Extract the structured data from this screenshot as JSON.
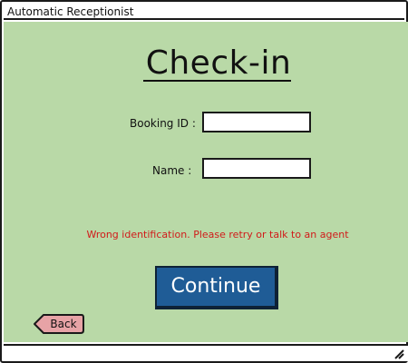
{
  "window": {
    "title": "Automatic Receptionist"
  },
  "main": {
    "heading": "Check-in",
    "booking_id_label": "Booking ID :",
    "booking_id_value": "",
    "name_label": "Name :",
    "name_value": "",
    "error_message": "Wrong identification. Please retry or talk to an agent",
    "continue_label": "Continue",
    "back_label": "Back"
  },
  "colors": {
    "background": "#b9d9a7",
    "error": "#d11a1a",
    "primary_button": "#1f5c96",
    "back_button": "#e7a3a6"
  },
  "icons": {
    "statusbar": "resize-grip-icon"
  }
}
